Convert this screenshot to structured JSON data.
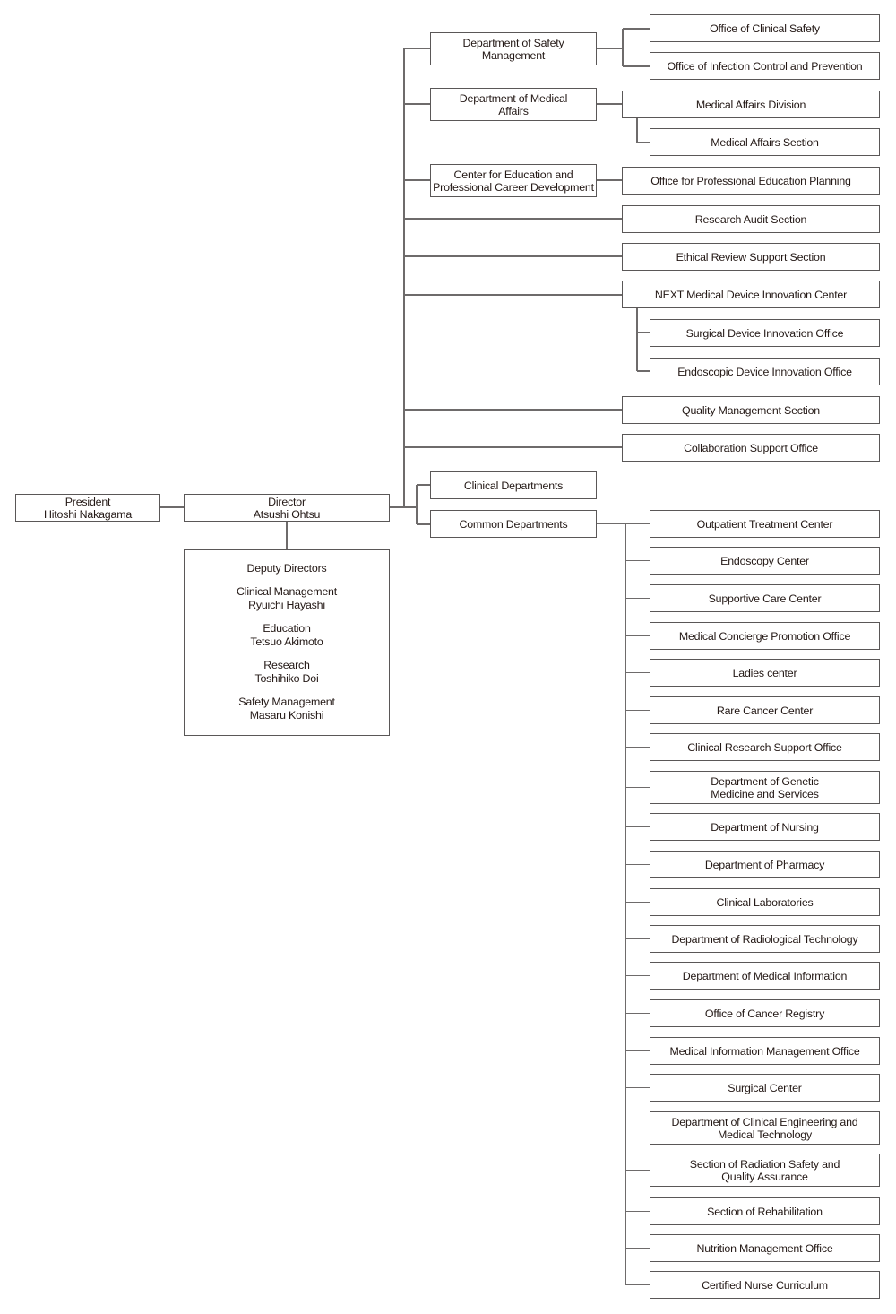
{
  "president": {
    "title": "President",
    "name": "Hitoshi Nakagama"
  },
  "director": {
    "title": "Director",
    "name": "Atsushi Ohtsu"
  },
  "deputy_directors": {
    "heading": "Deputy Directors",
    "members": [
      {
        "role": "Clinical Management",
        "name": "Ryuichi Hayashi"
      },
      {
        "role": "Education",
        "name": "Tetsuo Akimoto"
      },
      {
        "role": "Research",
        "name": "Toshihiko Doi"
      },
      {
        "role": "Safety Management",
        "name": "Masaru Konishi"
      }
    ]
  },
  "upper_units": [
    {
      "label": [
        "Department of Safety",
        "Management"
      ],
      "children": [
        "Office of Clinical Safety",
        "Office of Infection Control and Prevention"
      ]
    },
    {
      "label": [
        "Department of Medical",
        "Affairs"
      ],
      "children": [
        "Medical Affairs Division",
        "Medical Affairs Section"
      ]
    },
    {
      "label": [
        "Center for Education and",
        "Professional Career Development"
      ],
      "children": [
        "Office for Professional Education Planning"
      ]
    },
    {
      "label": [
        "Research Audit Section"
      ]
    },
    {
      "label": [
        "Ethical Review Support Section"
      ]
    },
    {
      "label": [
        "NEXT Medical Device Innovation Center"
      ],
      "children": [
        "Surgical Device Innovation Office",
        "Endoscopic Device Innovation Office"
      ]
    },
    {
      "label": [
        "Quality Management Section"
      ]
    },
    {
      "label": [
        "Collaboration Support Office"
      ]
    }
  ],
  "clinical_departments": "Clinical Departments",
  "common_departments": {
    "label": "Common Departments",
    "children": [
      [
        "Outpatient Treatment Center"
      ],
      [
        "Endoscopy Center"
      ],
      [
        "Supportive Care Center"
      ],
      [
        "Medical Concierge Promotion Office"
      ],
      [
        "Ladies center"
      ],
      [
        "Rare Cancer Center"
      ],
      [
        "Clinical Research Support Office"
      ],
      [
        "Department of Genetic",
        "Medicine and Services"
      ],
      [
        "Department of Nursing"
      ],
      [
        "Department of Pharmacy"
      ],
      [
        "Clinical Laboratories"
      ],
      [
        "Department of Radiological Technology"
      ],
      [
        "Department of Medical Information"
      ],
      [
        "Office of Cancer Registry"
      ],
      [
        "Medical Information Management Office"
      ],
      [
        "Surgical Center"
      ],
      [
        "Department of Clinical Engineering and",
        "Medical Technology"
      ],
      [
        "Section of Radiation Safety and",
        "Quality Assurance"
      ],
      [
        "Section of Rehabilitation"
      ],
      [
        "Nutrition Management Office"
      ],
      [
        "Certified Nurse Curriculum"
      ]
    ]
  }
}
